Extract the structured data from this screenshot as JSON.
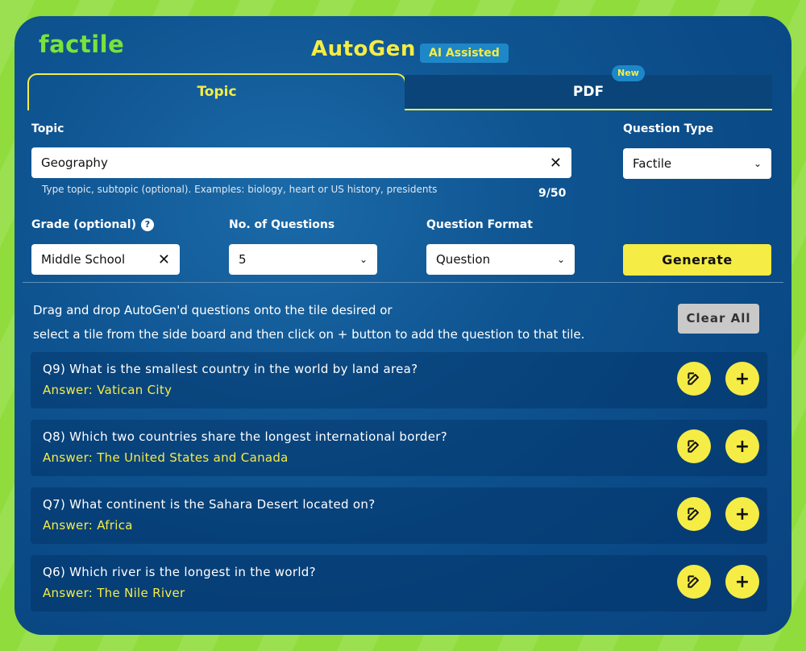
{
  "app": {
    "logo": "factile",
    "title": "AutoGen",
    "badge": "AI Assisted"
  },
  "tabs": [
    {
      "label": "Topic",
      "active": true
    },
    {
      "label": "PDF",
      "badge": "New"
    }
  ],
  "form": {
    "topic": {
      "label": "Topic",
      "value": "Geography",
      "hint": "Type topic, subtopic (optional). Examples: biology, heart or US history, presidents",
      "count": "9/50"
    },
    "question_type": {
      "label": "Question Type",
      "value": "Factile"
    },
    "grade": {
      "label": "Grade (optional)",
      "value": "Middle School"
    },
    "num_questions": {
      "label": "No. of Questions",
      "value": "5"
    },
    "question_format": {
      "label": "Question Format",
      "value": "Question"
    },
    "generate_label": "Generate"
  },
  "instructions": {
    "line1": "Drag and drop AutoGen'd questions onto the tile desired or",
    "line2": "select a tile from the side board and then click on + button to add the question to that tile.",
    "clear_all": "Clear All"
  },
  "questions": [
    {
      "q": "Q9) What is the smallest country in the world by land area?",
      "a": "Answer: Vatican City"
    },
    {
      "q": "Q8) Which two countries share the longest international border?",
      "a": "Answer: The United States and Canada"
    },
    {
      "q": "Q7) What continent is the Sahara Desert located on?",
      "a": "Answer: Africa"
    },
    {
      "q": "Q6) Which river is the longest in the world?",
      "a": "Answer: The Nile River"
    }
  ],
  "colors": {
    "accent": "#f5ec45",
    "panel": "#0a4a86",
    "logo": "#7be33a",
    "background": "#8fdc3c"
  }
}
